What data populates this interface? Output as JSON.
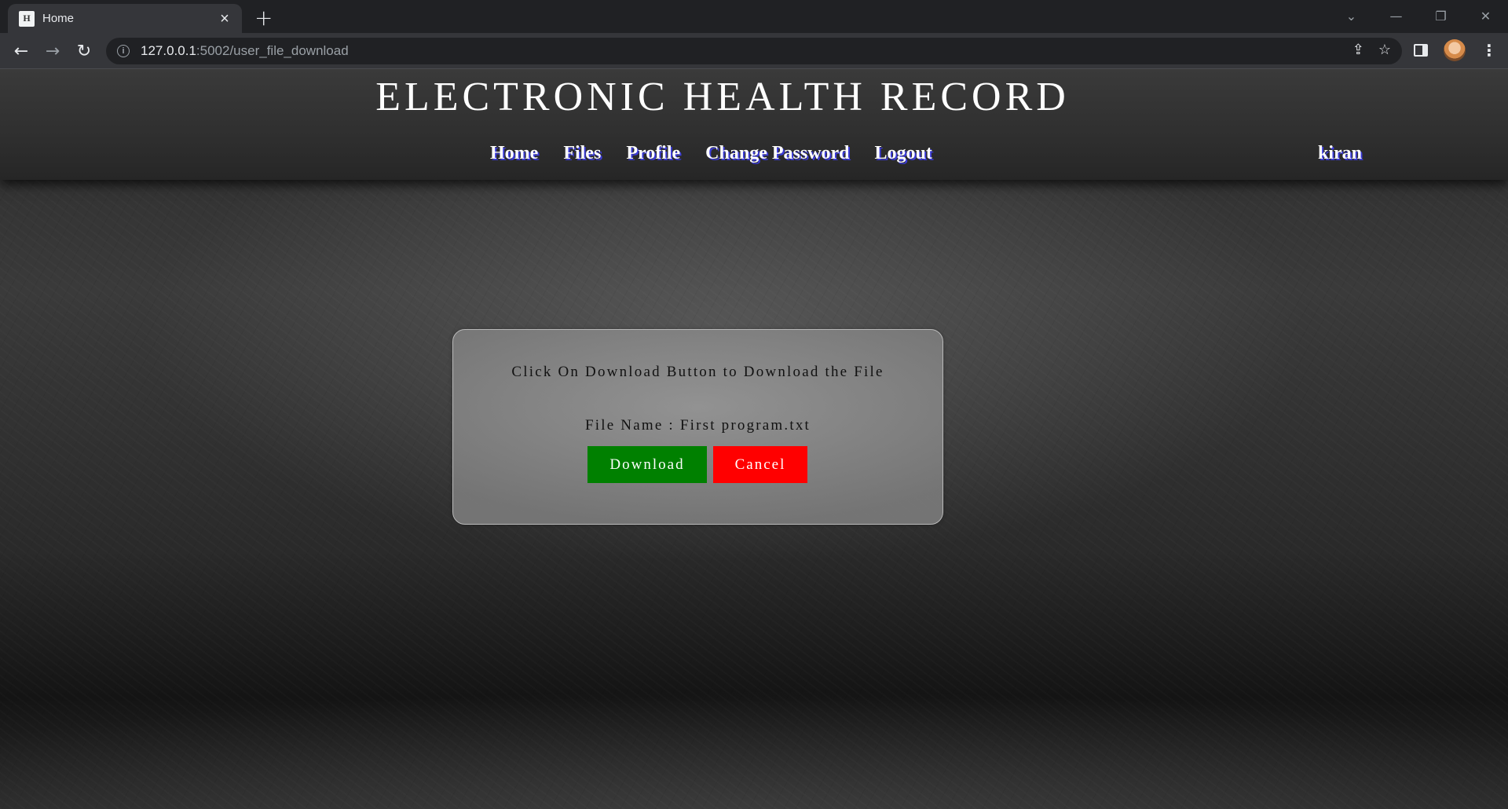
{
  "browser": {
    "tab_title": "Home",
    "tab_favicon": "H",
    "url_host": "127.0.0.1",
    "url_path": ":5002/user_file_download"
  },
  "header": {
    "site_title": "ELECTRONIC HEALTH RECORD",
    "nav": [
      {
        "label": "Home"
      },
      {
        "label": "Files"
      },
      {
        "label": "Profile"
      },
      {
        "label": "Change Password"
      },
      {
        "label": "Logout"
      }
    ],
    "user_name": "kiran"
  },
  "download_card": {
    "message": "Click On Download Button to Download the File",
    "file_label": "File Name : ",
    "file_name": "First program.txt",
    "download_label": "Download",
    "cancel_label": "Cancel"
  },
  "colors": {
    "download_button": "#008000",
    "cancel_button": "#ff0000",
    "nav_shadow": "#3b3bd6"
  }
}
